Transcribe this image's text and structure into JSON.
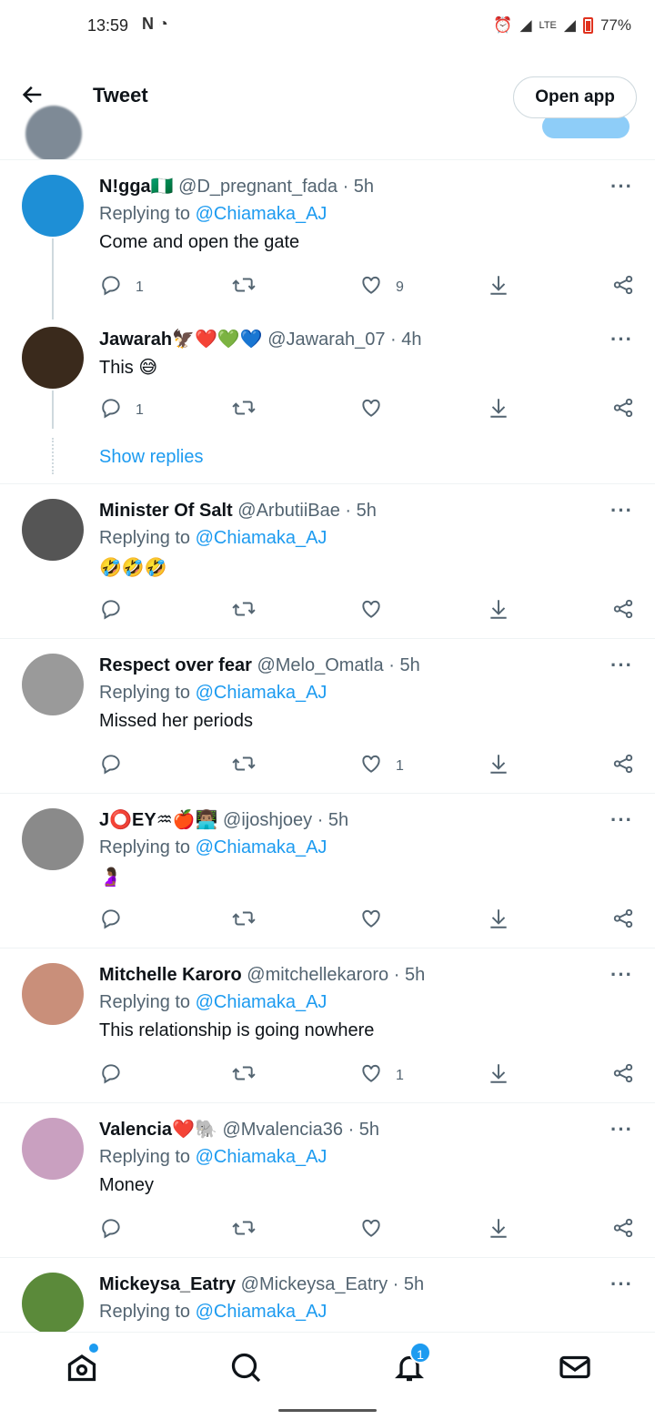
{
  "status": {
    "time": "13:59",
    "battery": "77%",
    "net": "LTE"
  },
  "header": {
    "title": "Tweet",
    "open_app": "Open app"
  },
  "tweets": [
    {
      "name": "N!gga",
      "name_emoji": "🇳🇬",
      "handle": "@D_pregnant_fada · 5h",
      "replying_label": "Replying to",
      "mention": "@Chiamaka_AJ",
      "text": "Come and open the gate",
      "replies": "1",
      "retweets": "",
      "likes": "9",
      "avatar_color": "#1e8fd6"
    },
    {
      "name": "Jawarah",
      "name_emoji": "🦅❤️💚💙",
      "handle": "@Jawarah_07 · 4h",
      "replying_label": "",
      "mention": "",
      "text": "This 😅",
      "replies": "1",
      "retweets": "",
      "likes": "",
      "avatar_color": "#3a2a1c"
    },
    {
      "name": "Minister Of Salt",
      "name_emoji": "",
      "handle": "@ArbutiiBae · 5h",
      "replying_label": "Replying to",
      "mention": "@Chiamaka_AJ",
      "text": "🤣🤣🤣",
      "replies": "",
      "retweets": "",
      "likes": "",
      "avatar_color": "#555555"
    },
    {
      "name": "Respect over fear",
      "name_emoji": "",
      "handle": "@Melo_Omatla · 5h",
      "replying_label": "Replying to",
      "mention": "@Chiamaka_AJ",
      "text": "Missed her periods",
      "replies": "",
      "retweets": "",
      "likes": "1",
      "avatar_color": "#9a9a9a"
    },
    {
      "name": "J⭕EY♒",
      "name_emoji": "🍎👨🏽‍💻",
      "handle": "@ijoshjoey · 5h",
      "replying_label": "Replying to",
      "mention": "@Chiamaka_AJ",
      "text": "🤰🏾",
      "replies": "",
      "retweets": "",
      "likes": "",
      "avatar_color": "#8a8a8a"
    },
    {
      "name": "Mitchelle Karoro",
      "name_emoji": "",
      "handle": "@mitchellekaroro · 5h",
      "replying_label": "Replying to",
      "mention": "@Chiamaka_AJ",
      "text": "This relationship is going nowhere",
      "replies": "",
      "retweets": "",
      "likes": "1",
      "avatar_color": "#c98f7a"
    },
    {
      "name": "Valencia",
      "name_emoji": "❤️🐘",
      "handle": "@Mvalencia36 · 5h",
      "replying_label": "Replying to",
      "mention": "@Chiamaka_AJ",
      "text": "Money",
      "replies": "",
      "retweets": "",
      "likes": "",
      "avatar_color": "#c9a0c0"
    },
    {
      "name": "Mickeysa_Eatry",
      "name_emoji": "",
      "handle": "@Mickeysa_Eatry · 5h",
      "replying_label": "Replying to",
      "mention": "@Chiamaka_AJ",
      "text": "",
      "replies": "",
      "retweets": "",
      "likes": "",
      "avatar_color": "#5b8a3a"
    }
  ],
  "show_replies": "Show replies",
  "nav": {
    "notifications_badge": "1"
  },
  "icons": [
    "back-arrow-icon",
    "reply-icon",
    "retweet-icon",
    "like-icon",
    "download-icon",
    "share-icon",
    "more-icon",
    "home-icon",
    "search-icon",
    "bell-icon",
    "mail-icon"
  ],
  "colors": {
    "accent": "#1d9bf0",
    "text": "#0f1419",
    "muted": "#536471"
  }
}
